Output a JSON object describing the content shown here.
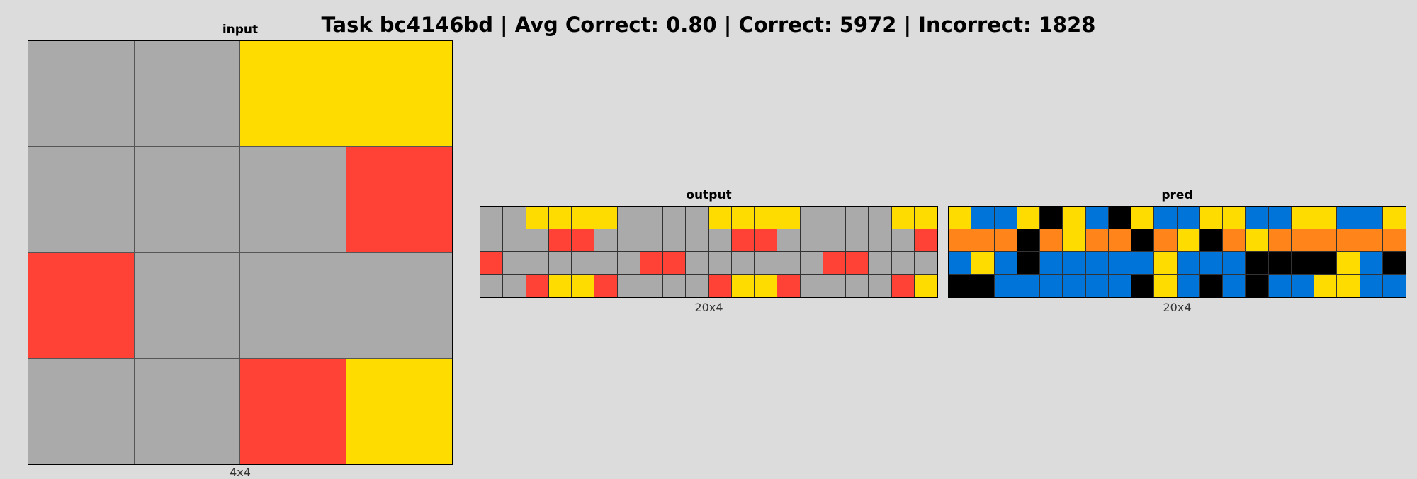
{
  "title": "Task bc4146bd | Avg Correct: 0.80 | Correct: 5972 | Incorrect: 1828",
  "colors": {
    "0": "#000000",
    "1": "#0074d9",
    "2": "#ff4136",
    "4": "#ffdc00",
    "5": "#aaaaaa",
    "7": "#ff851b",
    "background": "#dcdcdc"
  },
  "panels": [
    {
      "id": "input",
      "title": "input",
      "dims": "4x4",
      "grid": [
        [
          5,
          5,
          4,
          4
        ],
        [
          5,
          5,
          5,
          2
        ],
        [
          2,
          5,
          5,
          5
        ],
        [
          5,
          5,
          2,
          4
        ]
      ]
    },
    {
      "id": "output",
      "title": "output",
      "dims": "20x4",
      "grid": [
        [
          5,
          5,
          4,
          4,
          4,
          4,
          5,
          5,
          5,
          5,
          4,
          4,
          4,
          4,
          5,
          5,
          5,
          5,
          4,
          4
        ],
        [
          5,
          5,
          5,
          2,
          2,
          5,
          5,
          5,
          5,
          5,
          5,
          2,
          2,
          5,
          5,
          5,
          5,
          5,
          5,
          2
        ],
        [
          2,
          5,
          5,
          5,
          5,
          5,
          5,
          2,
          2,
          5,
          5,
          5,
          5,
          5,
          5,
          2,
          2,
          5,
          5,
          5
        ],
        [
          5,
          5,
          2,
          4,
          4,
          2,
          5,
          5,
          5,
          5,
          2,
          4,
          4,
          2,
          5,
          5,
          5,
          5,
          2,
          4
        ]
      ]
    },
    {
      "id": "pred",
      "title": "pred",
      "dims": "20x4",
      "grid": [
        [
          4,
          1,
          1,
          4,
          0,
          4,
          1,
          0,
          4,
          1,
          1,
          4,
          4,
          1,
          1,
          4,
          4,
          1,
          1,
          4
        ],
        [
          7,
          7,
          7,
          0,
          7,
          4,
          7,
          7,
          0,
          7,
          4,
          0,
          7,
          4,
          7,
          7,
          7,
          7,
          7,
          7
        ],
        [
          1,
          4,
          1,
          0,
          1,
          1,
          1,
          1,
          1,
          4,
          1,
          1,
          1,
          0,
          0,
          0,
          0,
          4,
          1,
          0
        ],
        [
          0,
          0,
          1,
          1,
          1,
          1,
          1,
          1,
          0,
          4,
          1,
          0,
          1,
          0,
          1,
          1,
          4,
          4,
          1,
          1
        ]
      ]
    }
  ]
}
